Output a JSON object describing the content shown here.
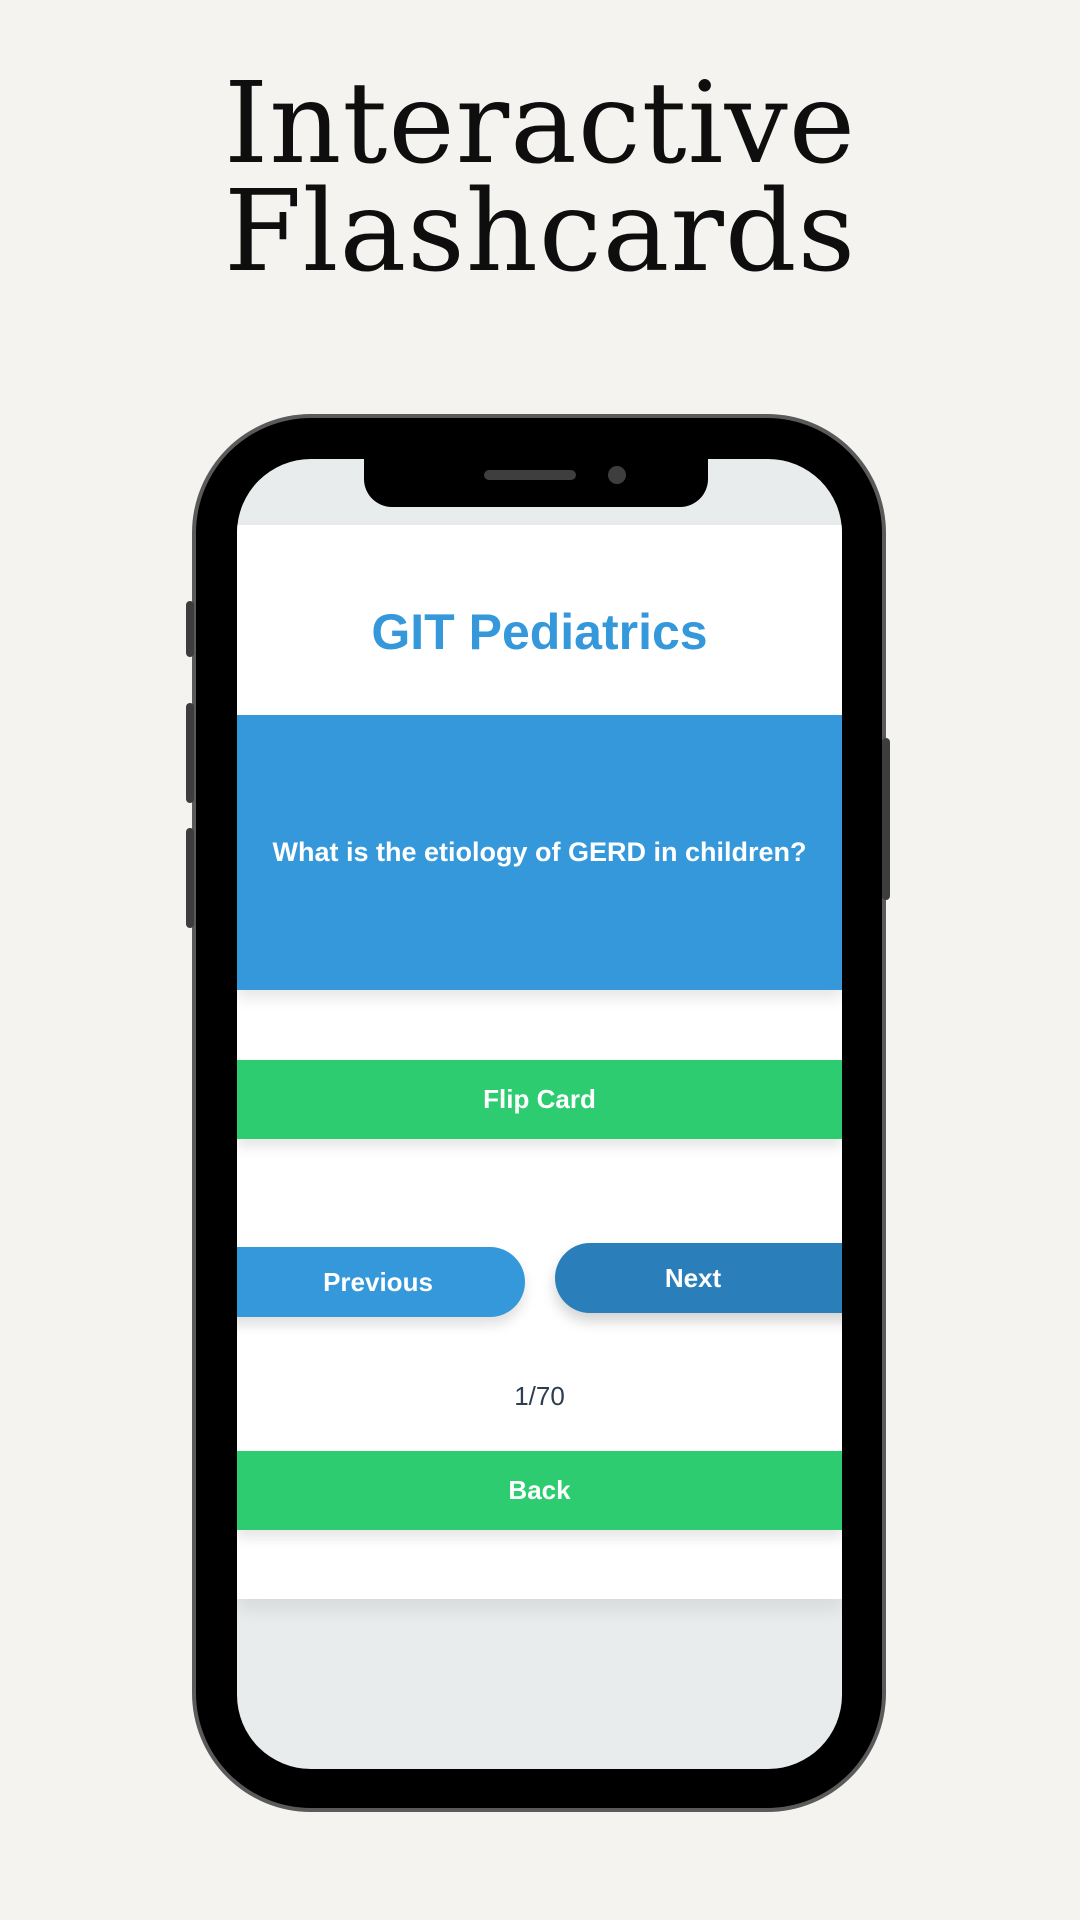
{
  "promo": {
    "headline_line1": "Interactive",
    "headline_line2": "Flashcards"
  },
  "app": {
    "title": "GIT Pediatrics",
    "card": {
      "question": "What is the etiology of GERD in children?"
    },
    "buttons": {
      "flip": "Flip Card",
      "previous": "Previous",
      "next": "Next",
      "back": "Back"
    },
    "progress": {
      "label": "1/70",
      "current": 1,
      "total": 70
    }
  },
  "colors": {
    "page_background": "#f4f3ef",
    "primary_blue": "#3498db",
    "next_blue": "#2a7fba",
    "green": "#2ecc71",
    "counter_text": "#2c3e50",
    "device_body": "#000000"
  }
}
